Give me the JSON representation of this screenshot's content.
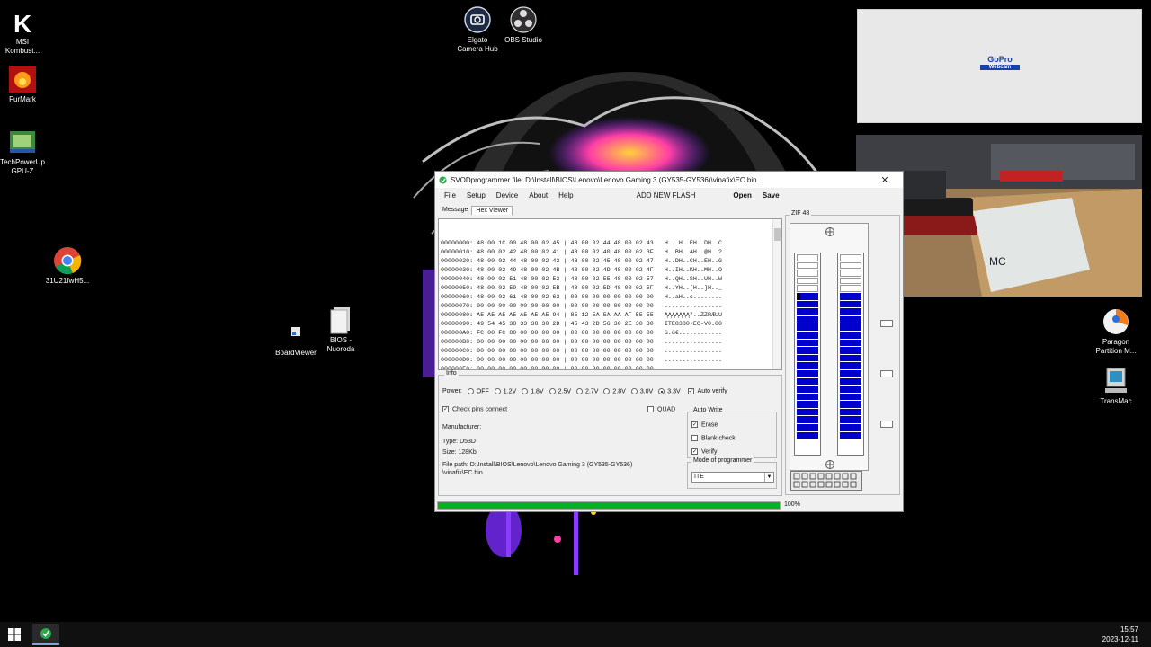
{
  "desktop": {
    "icons": [
      {
        "label_line1": "MSI",
        "label_line2": "Kombust...",
        "icon": "msi-kombustor-icon"
      },
      {
        "label_line1": "FurMark",
        "label_line2": "",
        "icon": "furmark-icon"
      },
      {
        "label_line1": "TechPowerUp",
        "label_line2": "GPU-Z",
        "icon": "gpu-z-icon"
      },
      {
        "label_line1": "31U21fwH5...",
        "label_line2": "",
        "icon": "chrome-icon"
      },
      {
        "label_line1": "BoardViewer",
        "label_line2": "",
        "icon": "boardviewer-shortcut-icon"
      },
      {
        "label_line1": "BIOS -",
        "label_line2": "Nuoroda",
        "icon": "bios-shortcut-icon"
      },
      {
        "label_line1": "Elgato",
        "label_line2": "Camera Hub",
        "icon": "elgato-icon"
      },
      {
        "label_line1": "OBS Studio",
        "label_line2": "",
        "icon": "obs-icon"
      },
      {
        "label_line1": "Paragon",
        "label_line2": "Partition M...",
        "icon": "paragon-icon"
      },
      {
        "label_line1": "TransMac",
        "label_line2": "",
        "icon": "transmac-icon"
      }
    ]
  },
  "gopro": {
    "logo": "GoPro",
    "sub": "Webcam"
  },
  "camera_overlay": {
    "label_text": "MC"
  },
  "app": {
    "title": "SVODprogrammer file: D:\\Install\\BIOS\\Lenovo\\Lenovo Gaming 3 (GY535-GY536)\\vinafix\\EC.bin",
    "close": "✕",
    "menu": {
      "file": "File",
      "setup": "Setup",
      "device": "Device",
      "about": "About",
      "help": "Help",
      "add_new_flash": "ADD NEW FLASH",
      "open": "Open",
      "save": "Save"
    },
    "tabs": {
      "message": "Message",
      "hex_viewer": "Hex Viewer"
    },
    "hex_rows": [
      "00000000: 48 00 1C 00 48 00 02 45 | 48 00 02 44 48 00 02 43   H...H..EH..DH..C",
      "00000010: 48 00 02 42 48 00 02 41 | 48 00 02 40 48 00 02 3F   H..BH..AH..@H..?",
      "00000020: 48 00 02 44 48 00 02 43 | 48 00 02 45 48 00 02 47   H..DH..CH..EH..G",
      "00000030: 48 00 02 49 48 00 02 4B | 48 00 02 4D 48 00 02 4F   H..IH..KH..MH..O",
      "00000040: 48 00 02 51 48 00 02 53 | 48 00 02 55 48 00 02 57   H..QH..SH..UH..W",
      "00000050: 48 00 02 59 48 00 02 5B | 48 00 02 5D 48 00 02 5F   H..YH..[H..]H.._",
      "00000060: 48 00 02 61 48 00 02 63 | 00 00 00 00 00 00 00 00   H..aH..c........",
      "00000070: 00 00 00 00 00 00 00 00 | 00 00 00 00 00 00 00 00   ................",
      "00000080: A5 A5 A5 A5 A5 A5 A5 94 | 85 12 5A 5A AA AF 55 55   ĄĄĄĄĄĄĄ\"..ZZRÆUU",
      "00000090: 49 54 45 38 33 38 30 2D | 45 43 2D 56 30 2E 30 30   ITE8380-EC-V0.00",
      "000000A0: FC 00 FC 80 00 00 00 00 | 00 00 00 00 00 00 00 00   ü.ü€............",
      "000000B0: 00 00 00 00 00 00 00 00 | 00 00 00 00 00 00 00 00   ................",
      "000000C0: 00 00 00 00 00 00 00 00 | 00 00 00 00 00 00 00 00   ................",
      "000000D0: 00 00 00 00 00 00 00 00 | 00 00 00 00 00 00 00 00   ................",
      "000000E0: 00 00 00 00 00 00 00 00 | 00 00 00 00 00 00 00 00   ................",
      "000000F0: 00 00 00 00 00 00 00 00 | 00 00 00 00 00 00 00 00   ................"
    ],
    "info": {
      "legend": "Info",
      "power_label": "Power:",
      "power_options": [
        "OFF",
        "1.2V",
        "1.8V",
        "2.5V",
        "2.7V",
        "2.8V",
        "3.0V",
        "3.3V"
      ],
      "power_selected": "3.3V",
      "auto_verify": "Auto verify",
      "check_pins": "Check pins connect",
      "quad": "QUAD",
      "manufacturer": "Manufacturer:",
      "type": "Type: D53D",
      "size": "Size: 128Kb",
      "file_path_1": "File path: D:\\Install\\BIOS\\Lenovo\\Lenovo Gaming 3 (GY535-GY536)",
      "file_path_2": "\\vinafix\\EC.bin"
    },
    "auto_write": {
      "legend": "Auto Write",
      "erase": "Erase",
      "blank_check": "Blank check",
      "verify": "Verify"
    },
    "mode": {
      "legend": "Mode of programmer",
      "value": "ITE",
      "arrow": "▼"
    },
    "zif": {
      "legend": "ZIF 48"
    },
    "progress": {
      "value": 1.0,
      "text": "100%",
      "color": "#06b025"
    }
  },
  "taskbar": {
    "time": "15:57",
    "date": "2023-12-11"
  }
}
